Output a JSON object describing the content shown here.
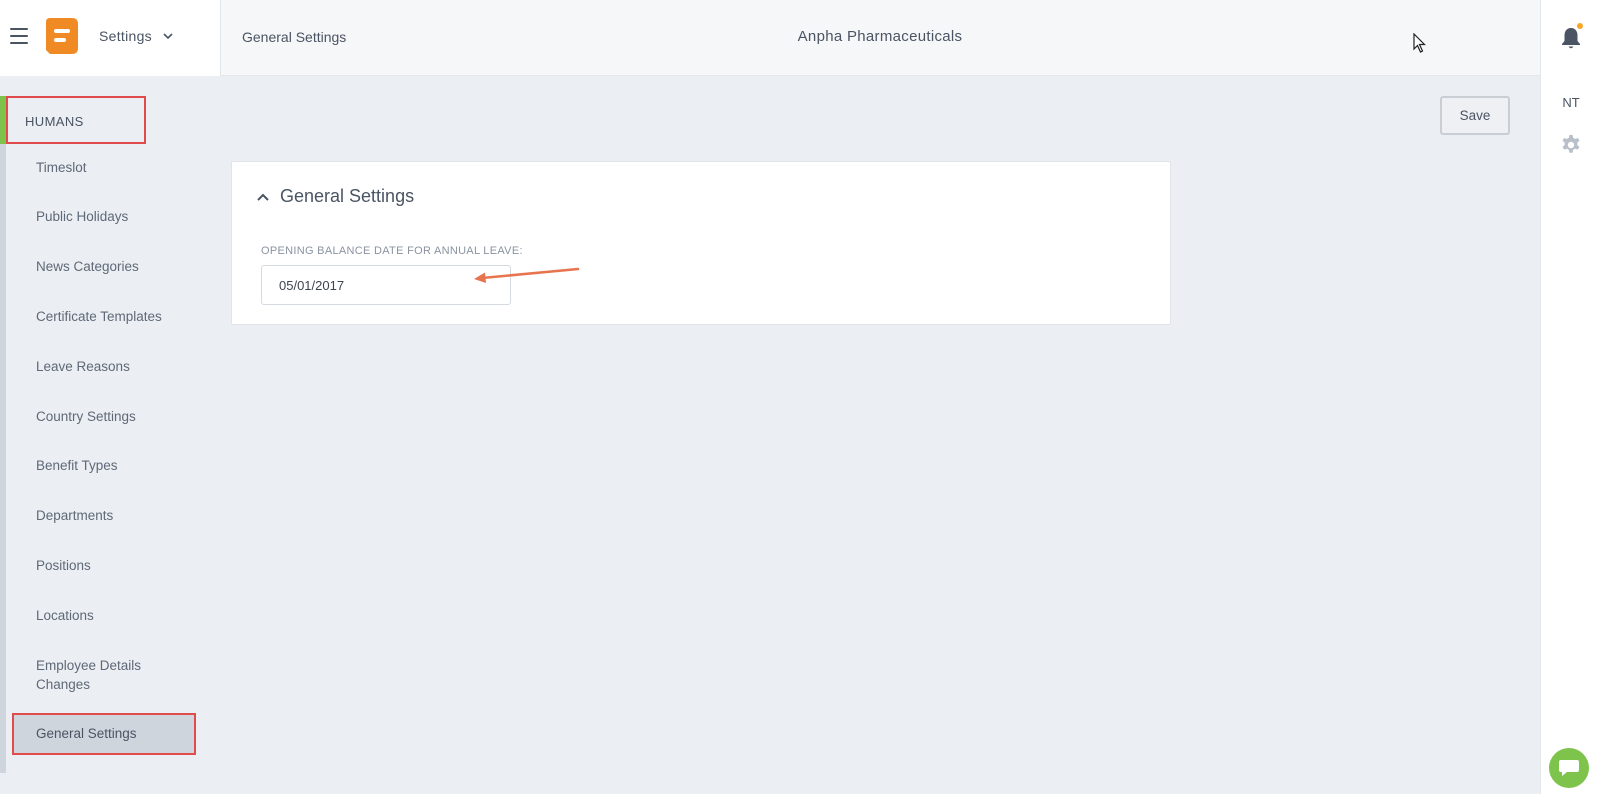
{
  "header": {
    "app_name": "Settings",
    "breadcrumb": "General Settings",
    "company": "Anpha Pharmaceuticals"
  },
  "right_rail": {
    "user_initials": "NT"
  },
  "sidebar": {
    "section": "HUMANS",
    "items": [
      {
        "label": "Timeslot"
      },
      {
        "label": "Public Holidays"
      },
      {
        "label": "News Categories"
      },
      {
        "label": "Certificate Templates"
      },
      {
        "label": "Leave Reasons"
      },
      {
        "label": "Country Settings"
      },
      {
        "label": "Benefit Types"
      },
      {
        "label": "Departments"
      },
      {
        "label": "Positions"
      },
      {
        "label": "Locations"
      },
      {
        "label": "Employee Details Changes"
      }
    ],
    "active_item": "General Settings"
  },
  "toolbar": {
    "save_label": "Save"
  },
  "card": {
    "title": "General Settings",
    "field_label": "OPENING BALANCE DATE FOR ANNUAL LEAVE:",
    "field_value": "05/01/2017"
  },
  "colors": {
    "accent_green": "#7ec34b",
    "logo_orange": "#f08a24",
    "highlight_red": "#e14b4b",
    "annotation_arrow": "#e8744f",
    "notification_dot": "#f5a623"
  }
}
